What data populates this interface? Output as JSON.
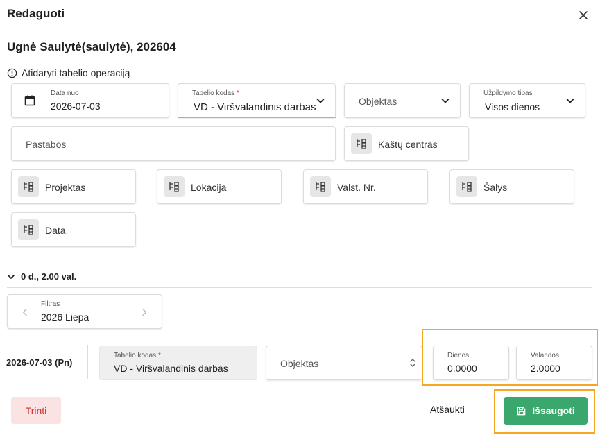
{
  "dialog": {
    "title": "Redaguoti",
    "employee": "Ugnė Saulytė(saulytė), 202604",
    "info_text": "Atidaryti tabelio operaciją"
  },
  "form": {
    "date_from": {
      "label": "Data nuo",
      "value": "2026-07-03"
    },
    "timesheet_code": {
      "label": "Tabelio kodas",
      "value": "VD - Viršvalandinis darbas"
    },
    "object": {
      "placeholder": "Objektas"
    },
    "fill_type": {
      "label": "Užpildymo tipas",
      "value": "Visos dienos"
    },
    "notes": {
      "placeholder": "Pastabos"
    },
    "cost_center": {
      "label": "Kaštų centras"
    },
    "project": {
      "label": "Projektas"
    },
    "location": {
      "label": "Lokacija"
    },
    "plate": {
      "label": "Valst. Nr."
    },
    "countries": {
      "label": "Šalys"
    },
    "data": {
      "label": "Data"
    }
  },
  "summary": {
    "text": "0 d., 2.00 val."
  },
  "filter": {
    "label": "Filtras",
    "value": "2026 Liepa"
  },
  "row": {
    "date": "2026-07-03 (Pn)",
    "timesheet_code": {
      "label": "Tabelio kodas",
      "value": "VD - Viršvalandinis darbas"
    },
    "object": {
      "placeholder": "Objektas"
    },
    "days": {
      "label": "Dienos",
      "value": "0.0000"
    },
    "hours": {
      "label": "Valandos",
      "value": "2.0000"
    }
  },
  "actions": {
    "delete": "Trinti",
    "cancel": "Atšaukti",
    "save": "Išsaugoti"
  },
  "colors": {
    "accent_underline": "#f5a623",
    "highlight_border": "#f5a623",
    "save_button": "#3aa76d",
    "delete_bg": "#fbe3e3",
    "delete_text": "#d32f2f",
    "required_star": "#d32f2f"
  }
}
